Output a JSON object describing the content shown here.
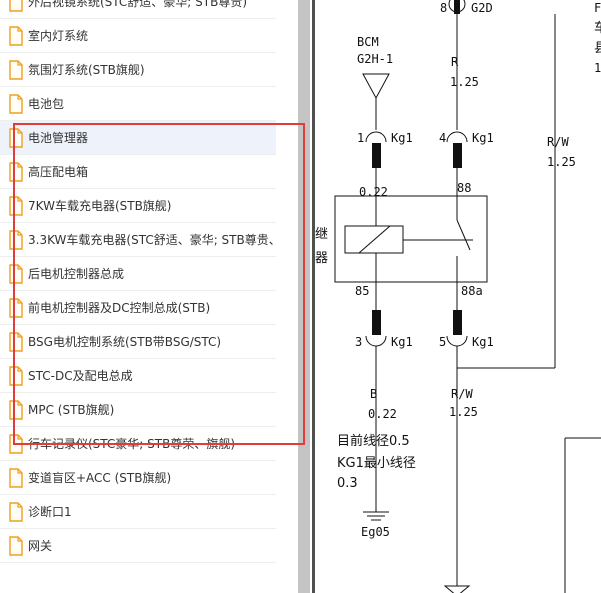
{
  "sidebar": {
    "items": [
      {
        "label": "外后视镜系统(STC舒适、豪华; STB尊贵)"
      },
      {
        "label": "室内灯系统"
      },
      {
        "label": "氛围灯系统(STB旗舰)"
      },
      {
        "label": "电池包"
      },
      {
        "label": "电池管理器"
      },
      {
        "label": "高压配电箱"
      },
      {
        "label": "7KW车载充电器(STB旗舰)"
      },
      {
        "label": "3.3KW车载充电器(STC舒适、豪华; STB尊贵、"
      },
      {
        "label": "后电机控制器总成"
      },
      {
        "label": "前电机控制器及DC控制总成(STB)"
      },
      {
        "label": "BSG电机控制系统(STB带BSG/STC)"
      },
      {
        "label": "STC-DC及配电总成"
      },
      {
        "label": "MPC (STB旗舰)"
      },
      {
        "label": "行车记录仪(STC豪华; STB尊荣、旗舰)"
      },
      {
        "label": "变道盲区+ACC (STB旗舰)"
      },
      {
        "label": "诊断口1"
      },
      {
        "label": "网关"
      }
    ],
    "selected_index": 4
  },
  "schematic": {
    "pin8_num": "8",
    "pin8_conn": "G2D",
    "corner_f": "F",
    "corner_c1": "车",
    "corner_c2": "县",
    "corner_1": "1",
    "bcm_label": "BCM",
    "bcm_conn": "G2H-1",
    "wire_r": "R",
    "wire_r_size": "1.25",
    "pin1_num": "1",
    "pin1_conn": "Kg1",
    "pin4_num": "4",
    "pin4_conn": "Kg1",
    "wire_rw_right": "R/W",
    "wire_rw_right_size": "1.25",
    "size_022_top": "0.22",
    "relay_pin_88": "88",
    "relay_label_a": "继",
    "relay_label_b": "器",
    "relay_pin_85": "85",
    "relay_pin_88a": "88a",
    "pin3_num": "3",
    "pin3_conn": "Kg1",
    "pin5_num": "5",
    "pin5_conn": "Kg1",
    "wire_b": "B",
    "wire_b_size": "0.22",
    "wire_rw": "R/W",
    "wire_rw_size": "1.25",
    "note_line1": "目前线径0.5",
    "note_line2": "KG1最小线径",
    "note_line3": "0.3",
    "ground": "Eg05"
  },
  "colors": {
    "highlight": "#e23b3b",
    "selected_bg": "#eef3fb",
    "doc_icon": "#f0a020",
    "connector": "#111111"
  },
  "icons": {
    "list_item": "document-icon"
  }
}
